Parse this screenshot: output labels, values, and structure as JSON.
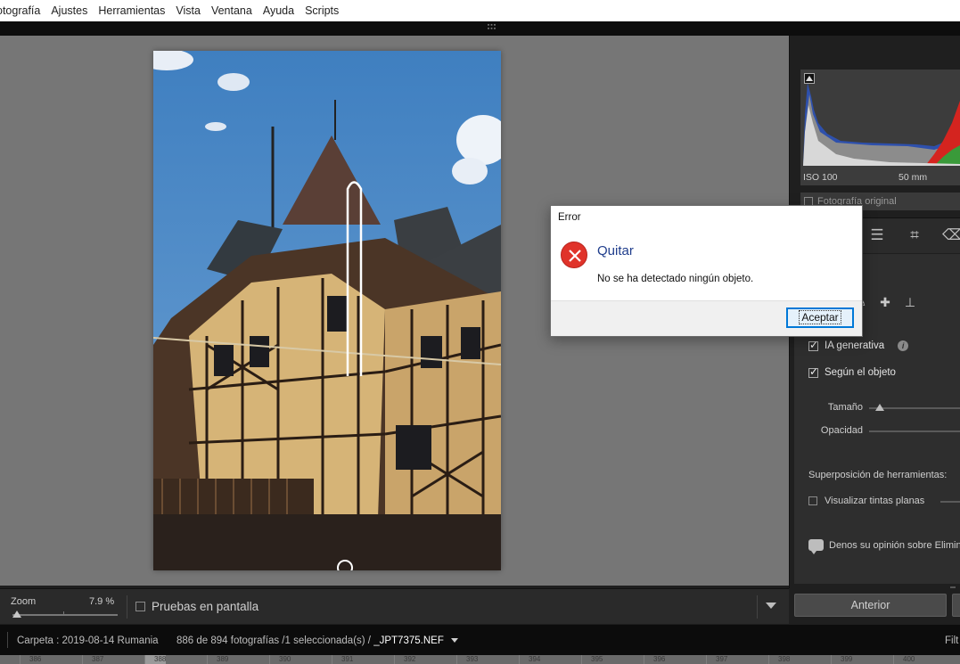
{
  "menu": [
    "otografía",
    "Ajustes",
    "Herramientas",
    "Vista",
    "Ventana",
    "Ayuda",
    "Scripts"
  ],
  "histogram": {
    "iso": "ISO 100",
    "focal": "50 mm",
    "original_label": "Fotografía original"
  },
  "panel": {
    "ia_generativa": "IA  generativa",
    "segun_objeto": "Según el objeto",
    "tamano": "Tamaño",
    "opacidad": "Opacidad",
    "superposicion": "Superposición de herramientas:",
    "tintas": "Visualizar tintas planas",
    "feedback": "Denos su opinión sobre Eliminar",
    "anterior": "Anterior"
  },
  "toolbar": {
    "zoom_label": "Zoom",
    "zoom_value": "7.9 %",
    "proof_label": "Pruebas en pantalla"
  },
  "status": {
    "folder": "Carpeta : 2019-08-14 Rumania",
    "count": "886 de 894 fotografías /1 seleccionada(s) /",
    "filename": "_JPT7375.NEF",
    "filter": "Filt"
  },
  "filmstrip": [
    "386",
    "387",
    "388",
    "389",
    "390",
    "391",
    "392",
    "393",
    "394",
    "395",
    "396",
    "397",
    "398",
    "399",
    "400"
  ],
  "dialog": {
    "title": "Error",
    "heading": "Quitar",
    "message": "No se ha detectado ningún objeto.",
    "ok_label": "Aceptar"
  },
  "icons": {
    "error": "error-x-icon",
    "tools": [
      "sliders-icon",
      "crop-icon",
      "eraser-icon"
    ],
    "subtools": [
      "brush-icon",
      "heal-icon",
      "stamp-icon"
    ]
  },
  "colors": {
    "dialog_heading": "#1f3d8c",
    "error_red": "#e0332a",
    "button_focus": "#0078d7"
  }
}
